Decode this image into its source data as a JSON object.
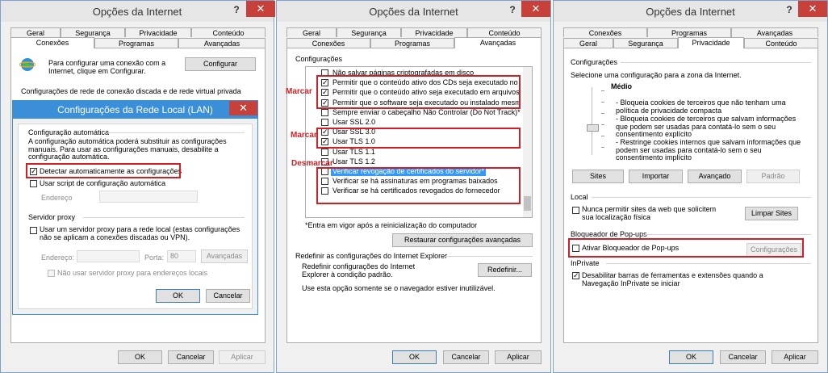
{
  "w1": {
    "title": "Opções da Internet",
    "help": "?",
    "close": "✕",
    "tabs_row1": [
      "Geral",
      "Segurança",
      "Privacidade",
      "Conteúdo"
    ],
    "tabs_row2": [
      "Conexões",
      "Programas",
      "Avançadas"
    ],
    "setup_text": "Para configurar uma conexão com a Internet, clique em Configurar.",
    "setup_btn": "Configurar",
    "dialup_text": "Configurações de rede de conexão discada e de rede virtual privada",
    "buttons": {
      "ok": "OK",
      "cancel": "Cancelar",
      "apply": "Aplicar"
    },
    "lan": {
      "title": "Configurações da Rede Local (LAN)",
      "close": "✕",
      "auto_group": "Configuração automática",
      "auto_desc": "A configuração automática poderá substituir as configurações manuais. Para usar as configurações manuais, desabilite a configuração automática.",
      "detect_label": "Detectar automaticamente as configurações",
      "script_label": "Usar script de configuração automática",
      "address_label": "Endereço",
      "proxy_group": "Servidor proxy",
      "proxy_label": "Usar um servidor proxy para a rede local (estas configurações não se aplicam a conexões discadas ou VPN).",
      "proxy_address_label": "Endereço:",
      "port_label": "Porta:",
      "port_value": "80",
      "advanced_btn": "Avançadas",
      "bypass_label": "Não usar servidor proxy para endereços locais",
      "ok": "OK",
      "cancel": "Cancelar"
    }
  },
  "w2": {
    "title": "Opções da Internet",
    "help": "?",
    "close": "✕",
    "tabs_row1": [
      "Geral",
      "Segurança",
      "Privacidade",
      "Conteúdo"
    ],
    "tabs_row2": [
      "Conexões",
      "Programas",
      "Avançadas"
    ],
    "settings_label": "Configurações",
    "items": [
      {
        "label": "Não salvar páginas criptografadas em disco",
        "checked": false
      },
      {
        "label": "Permitir que o conteúdo ativo dos CDs seja executado no",
        "checked": true
      },
      {
        "label": "Permitir que o conteúdo ativo seja executado em arquivos",
        "checked": true
      },
      {
        "label": "Permitir que o software seja executado ou instalado mesm",
        "checked": true
      },
      {
        "label": "Sempre enviar o cabeçalho Não Controlar (Do Not Track)*",
        "checked": false
      },
      {
        "label": "Usar SSL 2.0",
        "checked": false
      },
      {
        "label": "Usar SSL 3.0",
        "checked": true
      },
      {
        "label": "Usar TLS 1.0",
        "checked": true
      },
      {
        "label": "Usar TLS 1.1",
        "checked": false
      },
      {
        "label": "Usar TLS 1.2",
        "checked": false
      },
      {
        "label": "Verificar revogação de certificados do servidor*",
        "checked": false
      },
      {
        "label": "Verificar se há assinaturas em programas baixados",
        "checked": false
      },
      {
        "label": "Verificar se há certificados revogados do fornecedor",
        "checked": false
      }
    ],
    "marks": {
      "mark1": "Marcar",
      "mark2": "Marcar",
      "unmark": "Desmarcar"
    },
    "note": "*Entra em vigor após a reinicialização do computador",
    "restore_btn": "Restaurar configurações avançadas",
    "reset_group": "Redefinir as configurações do Internet Explorer",
    "reset_text": "Redefinir configurações do Internet Explorer à condição padrão.",
    "reset_btn": "Redefinir...",
    "reset_note": "Use esta opção somente se o navegador estiver inutilizável.",
    "buttons": {
      "ok": "OK",
      "cancel": "Cancelar",
      "apply": "Aplicar"
    }
  },
  "w3": {
    "title": "Opções da Internet",
    "help": "?",
    "close": "✕",
    "tabs_row1": [
      "Conexões",
      "Programas",
      "Avançadas"
    ],
    "tabs_row2": [
      "Geral",
      "Segurança",
      "Privacidade",
      "Conteúdo"
    ],
    "settings_label": "Configurações",
    "zone_text": "Selecione uma configuração para a zona da Internet.",
    "level": "Médio",
    "desc": [
      "- Bloqueia cookies de terceiros que não tenham uma política de privacidade compacta",
      "- Bloqueia cookies de terceiros que salvam informações que podem ser usadas para contatá-lo sem o seu consentimento explícito",
      "- Restringe cookies internos que salvam informações que podem ser usadas para contatá-lo sem o seu consentimento implícito"
    ],
    "sites_btn": "Sites",
    "import_btn": "Importar",
    "advanced_btn": "Avançado",
    "default_btn": "Padrão",
    "local_label": "Local",
    "never_allow": "Nunca permitir sites da web que solicitem sua localização física",
    "clear_sites_btn": "Limpar Sites",
    "popup_label": "Bloqueador de Pop-ups",
    "popup_cb": "Ativar Bloqueador de Pop-ups",
    "popup_settings_btn": "Configurações",
    "inprivate_label": "InPrivate",
    "inprivate_cb": "Desabilitar barras de ferramentas e extensões quando a Navegação InPrivate se iniciar",
    "buttons": {
      "ok": "OK",
      "cancel": "Cancelar",
      "apply": "Aplicar"
    }
  }
}
